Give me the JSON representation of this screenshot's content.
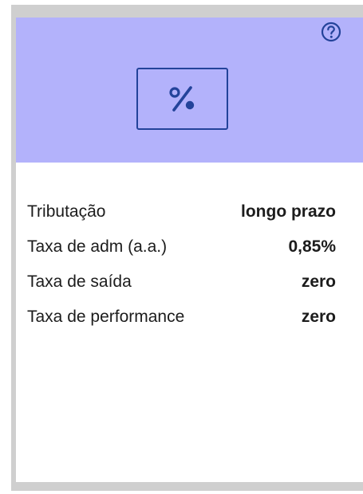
{
  "card": {
    "header_color": "#b3b2fb",
    "accent_color": "#23439a",
    "help_icon": "question-circle-icon",
    "main_icon": "percent-icon"
  },
  "rows": [
    {
      "label": "Tributação",
      "value": "longo prazo"
    },
    {
      "label": "Taxa de adm (a.a.)",
      "value": "0,85%"
    },
    {
      "label": "Taxa de saída",
      "value": "zero"
    },
    {
      "label": "Taxa de performance",
      "value": "zero"
    }
  ]
}
